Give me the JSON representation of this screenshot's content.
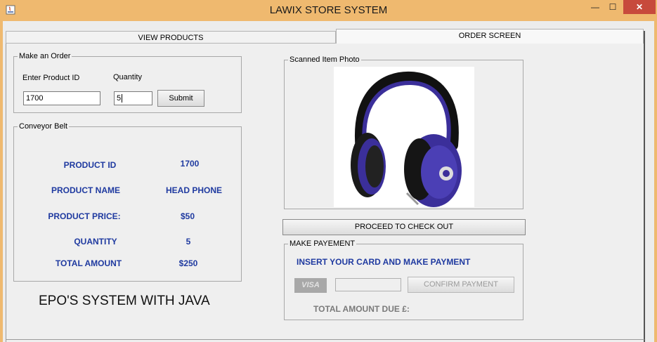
{
  "window": {
    "title": "LAWIX STORE SYSTEM",
    "close_glyph": "✕",
    "min_glyph": "—",
    "max_glyph": "☐"
  },
  "tabs": [
    {
      "label": "VIEW PRODUCTS",
      "active": false
    },
    {
      "label": "ORDER SCREEN",
      "active": true
    }
  ],
  "order": {
    "legend": "Make an Order",
    "product_id_label": "Enter Product ID",
    "quantity_label": "Quantity",
    "product_id_value": "1700",
    "quantity_value": "5",
    "submit_label": "Submit"
  },
  "belt": {
    "legend": "Conveyor Belt",
    "rows": [
      {
        "label": "PRODUCT ID",
        "value": "1700"
      },
      {
        "label": "PRODUCT NAME",
        "value": "HEAD PHONE"
      },
      {
        "label": "PRODUCT PRICE:",
        "value": "$50"
      },
      {
        "label": "QUANTITY",
        "value": "5"
      },
      {
        "label": "TOTAL AMOUNT",
        "value": "$250"
      }
    ]
  },
  "footer_text": "EPO'S SYSTEM WITH JAVA",
  "photo": {
    "legend": "Scanned Item Photo",
    "icon": "headphones-image"
  },
  "checkout_label": "PROCEED TO CHECK OUT",
  "payment": {
    "legend": "MAKE PAYEMENT",
    "instruction": "INSERT YOUR CARD AND MAKE PAYMENT",
    "visa_label": "VISA",
    "card_value": "",
    "confirm_label": "CONFIRM PAYMENT",
    "amount_due_label": "TOTAL AMOUNT DUE £:"
  },
  "colors": {
    "titlebar": "#efb96f",
    "label_blue": "#1f3aa0",
    "close_red": "#c74a3c",
    "headphone_purple": "#3b2f9a"
  }
}
